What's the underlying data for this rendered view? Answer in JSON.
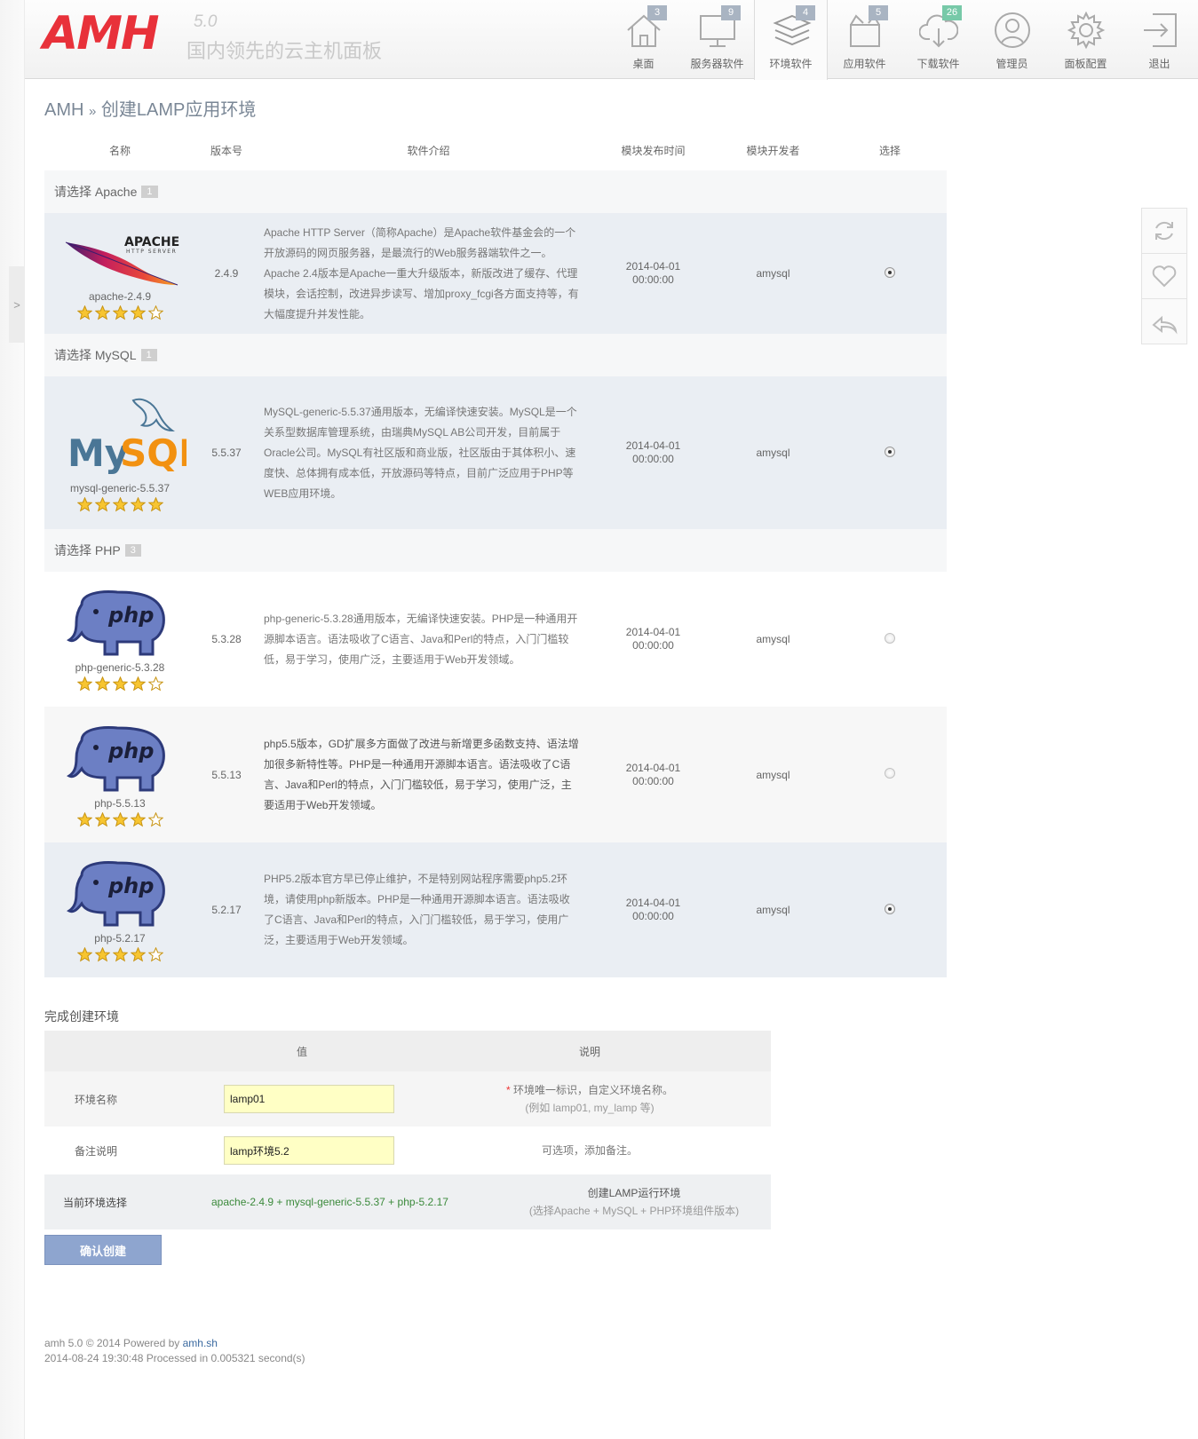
{
  "header": {
    "logo": "AMH",
    "version": "5.0",
    "slogan": "国内领先的云主机面板"
  },
  "nav": [
    {
      "label": "桌面",
      "badge": "3",
      "icon": "home-icon"
    },
    {
      "label": "服务器软件",
      "badge": "9",
      "icon": "monitor-icon"
    },
    {
      "label": "环境软件",
      "badge": "4",
      "icon": "layers-icon",
      "active": true
    },
    {
      "label": "应用软件",
      "badge": "5",
      "icon": "box-icon"
    },
    {
      "label": "下载软件",
      "badge": "26",
      "icon": "cloud-download-icon"
    },
    {
      "label": "管理员",
      "icon": "user-icon"
    },
    {
      "label": "面板配置",
      "icon": "gear-icon"
    },
    {
      "label": "退出",
      "icon": "logout-icon"
    }
  ],
  "left_toggle": ">",
  "breadcrumb": {
    "root": "AMH",
    "sep": "»",
    "current": "创建LAMP应用环境"
  },
  "table": {
    "headers": {
      "name": "名称",
      "version": "版本号",
      "desc": "软件介绍",
      "time": "模块发布时间",
      "dev": "模块开发者",
      "select": "选择"
    },
    "groups": [
      {
        "title": "请选择 Apache",
        "count": "1",
        "items": [
          {
            "logo": "apache-feather-logo",
            "name": "apache-2.4.9",
            "version": "2.4.9",
            "desc": [
              "Apache HTTP Server（简称Apache）是Apache软件基金会的一个",
              "开放源码的网页服务器，是最流行的Web服务器端软件之一。",
              "Apache 2.4版本是Apache一重大升级版本，新版改进了缓存、代理",
              "模块，会话控制，改进异步读写、增加proxy_fcgi各方面支持等，有",
              "大幅度提升并发性能。"
            ],
            "date": "2014-04-01",
            "clock": "00:00:00",
            "dev": "amysql",
            "rating": 4,
            "selected": true
          }
        ]
      },
      {
        "title": "请选择 MySQL",
        "count": "1",
        "items": [
          {
            "logo": "mysql-dolphin-logo",
            "name": "mysql-generic-5.5.37",
            "version": "5.5.37",
            "desc": [
              "MySQL-generic-5.5.37通用版本，无编译快速安装。MySQL是一个",
              "关系型数据库管理系统，由瑞典MySQL AB公司开发，目前属于",
              "Oracle公司。MySQL有社区版和商业版，社区版由于其体积小、速",
              "度快、总体拥有成本低，开放源码等特点，目前广泛应用于PHP等",
              "WEB应用环境。"
            ],
            "date": "2014-04-01",
            "clock": "00:00:00",
            "dev": "amysql",
            "rating": 5,
            "selected": true
          }
        ]
      },
      {
        "title": "请选择 PHP",
        "count": "3",
        "items": [
          {
            "logo": "php-elephant-logo",
            "name": "php-generic-5.3.28",
            "version": "5.3.28",
            "desc": [
              "php-generic-5.3.28通用版本，无编译快速安装。PHP是一种通用开",
              "源脚本语言。语法吸收了C语言、Java和Perl的特点，入门门槛较",
              "低，易于学习，使用广泛，主要适用于Web开发领域。"
            ],
            "date": "2014-04-01",
            "clock": "00:00:00",
            "dev": "amysql",
            "rating": 4,
            "selected": false
          },
          {
            "logo": "php-elephant-logo",
            "name": "php-5.5.13",
            "version": "5.5.13",
            "desc": [
              "php5.5版本，GD扩展多方面做了改进与新增更多函数支持、语法增",
              "加很多新特性等。PHP是一种通用开源脚本语言。语法吸收了C语",
              "言、Java和Perl的特点，入门门槛较低，易于学习，使用广泛，主",
              "要适用于Web开发领域。"
            ],
            "date": "2014-04-01",
            "clock": "00:00:00",
            "dev": "amysql",
            "rating": 4,
            "selected": false
          },
          {
            "logo": "php-elephant-logo",
            "name": "php-5.2.17",
            "version": "5.2.17",
            "desc": [
              "PHP5.2版本官方早已停止维护，不是特别网站程序需要php5.2环",
              "境，请使用php新版本。PHP是一种通用开源脚本语言。语法吸收",
              "了C语言、Java和Perl的特点，入门门槛较低，易于学习，使用广",
              "泛，主要适用于Web开发领域。"
            ],
            "date": "2014-04-01",
            "clock": "00:00:00",
            "dev": "amysql",
            "rating": 4,
            "selected": true
          }
        ]
      }
    ]
  },
  "form": {
    "title": "完成创建环境",
    "headers": {
      "value": "值",
      "note": "说明"
    },
    "env_name": {
      "label": "环境名称",
      "value": "lamp01",
      "req": "*",
      "hint1": "环境唯一标识，自定义环境名称。",
      "hint2": "(例如 lamp01, my_lamp 等)"
    },
    "remark": {
      "label": "备注说明",
      "value": "lamp环境5.2",
      "hint": "可选项，添加备注。"
    },
    "current": {
      "label": "当前环境选择",
      "apache": "apache-2.4.9",
      "plus": "+",
      "mysql": "mysql-generic-5.5.37",
      "php": "php-5.2.17",
      "hint1": "创建LAMP运行环境",
      "hint2": "(选择Apache + MySQL + PHP环境组件版本)"
    },
    "submit": "确认创建"
  },
  "footer": {
    "line1_prefix": "amh 5.0 © 2014 Powered by",
    "link": "amh.sh",
    "line2": "2014-08-24 19:30:48 Processed in 0.005321 second(s)"
  },
  "colors": {
    "brand": "#e8313a",
    "badge": "#a9b4c2",
    "badge_green": "#77c9a8",
    "button": "#8ea5cf",
    "input_bg": "#ffffc5"
  }
}
